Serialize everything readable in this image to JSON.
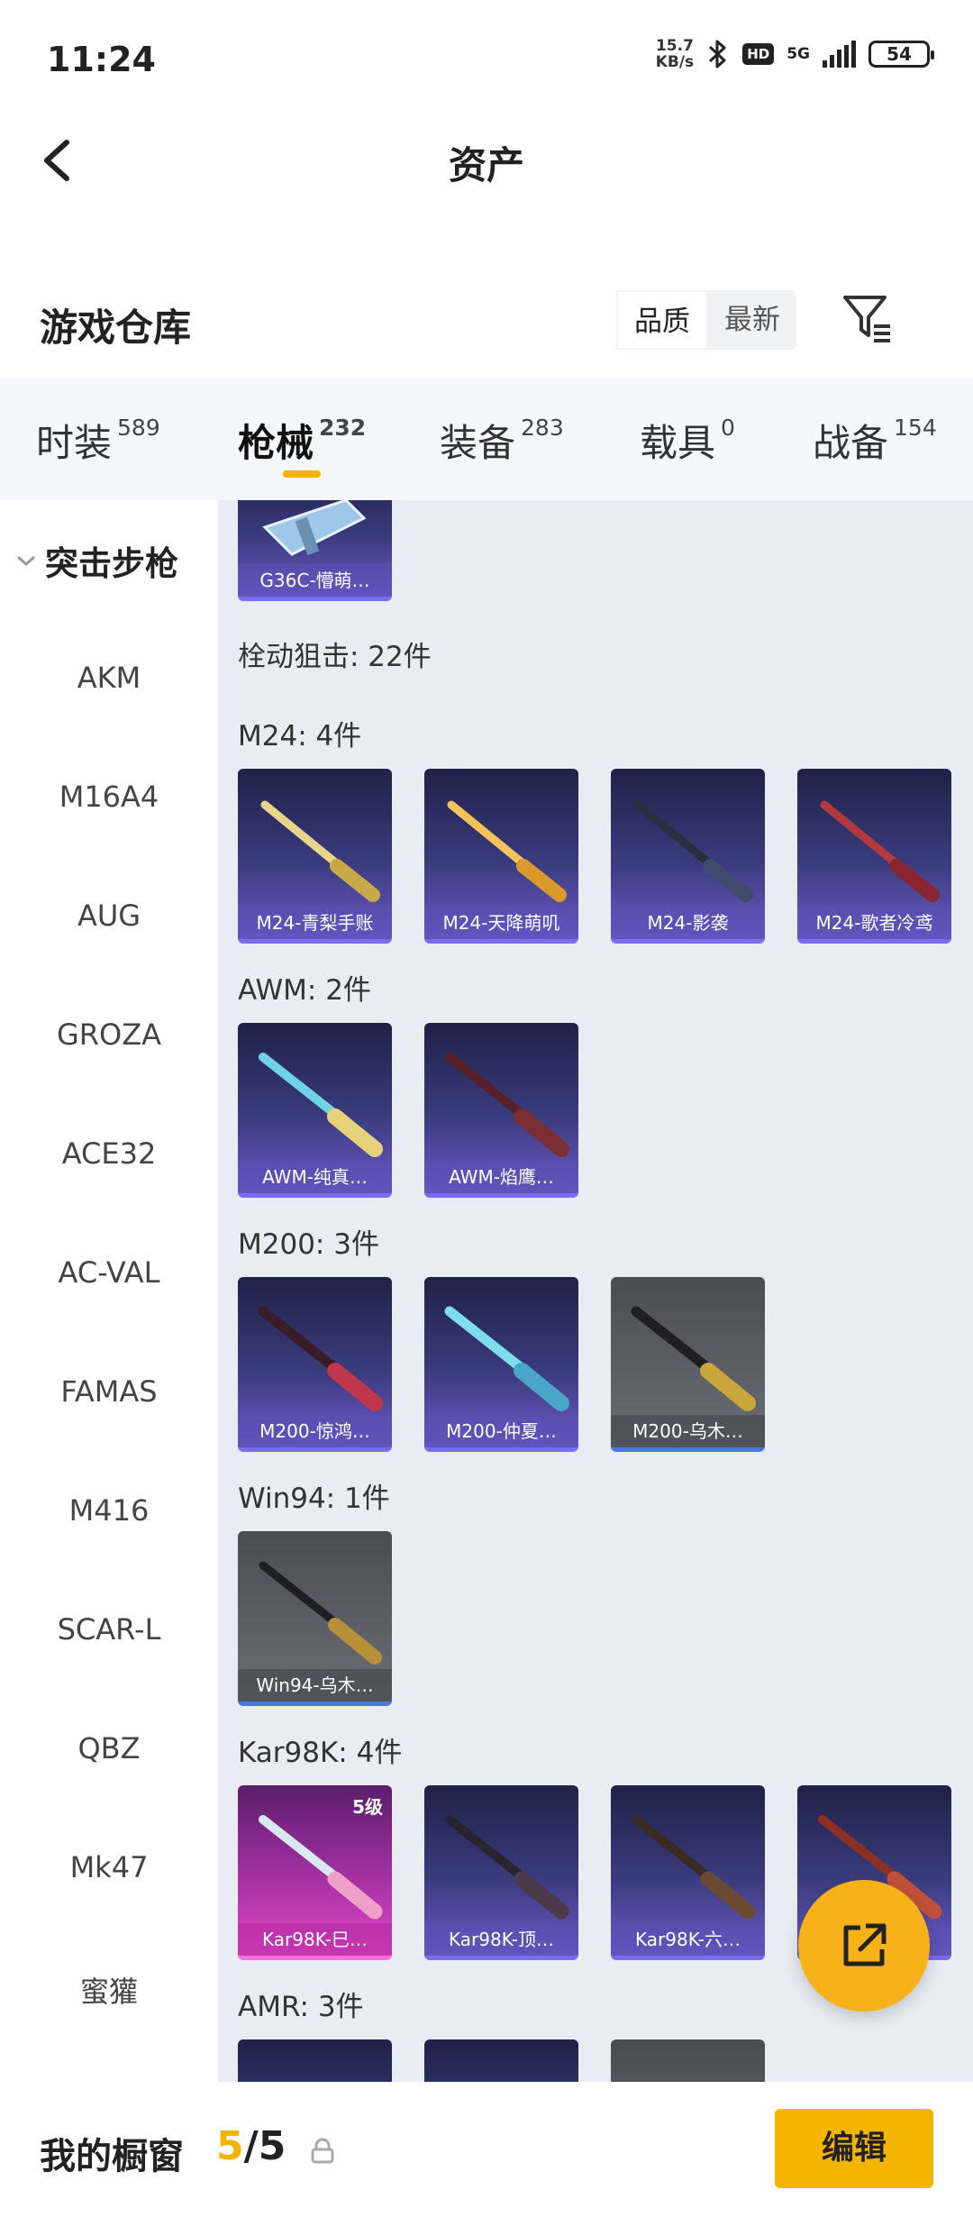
{
  "status_bar": {
    "time": "11:24",
    "net_speed_value": "15.7",
    "net_speed_unit": "KB/s",
    "hd_badge": "HD",
    "network": "5G",
    "battery": "54"
  },
  "header": {
    "title": "资产"
  },
  "section": {
    "title": "游戏仓库",
    "sort_options": [
      "品质",
      "最新"
    ],
    "sort_selected": "品质"
  },
  "tabs": [
    {
      "label": "时装",
      "count": "589"
    },
    {
      "label": "枪械",
      "count": "232"
    },
    {
      "label": "装备",
      "count": "283"
    },
    {
      "label": "载具",
      "count": "0"
    },
    {
      "label": "战备",
      "count": "154"
    }
  ],
  "active_tab": "枪械",
  "sidebar": {
    "category": "突击步枪",
    "items": [
      "AKM",
      "M16A4",
      "AUG",
      "GROZA",
      "ACE32",
      "AC-VAL",
      "FAMAS",
      "M416",
      "SCAR-L",
      "QBZ",
      "Mk47",
      "蜜獾"
    ]
  },
  "content": {
    "top_card": "G36C-懵萌…",
    "category_heading": "栓动狙击: 22件",
    "groups": [
      {
        "label": "M24: 4件",
        "items": [
          "M24-青梨手账",
          "M24-天降萌叽",
          "M24-影袭",
          "M24-歌者冷鸢"
        ]
      },
      {
        "label": "AWM: 2件",
        "items": [
          "AWM-纯真…",
          "AWM-焰鹰…"
        ]
      },
      {
        "label": "M200: 3件",
        "items": [
          "M200-惊鸿…",
          "M200-仲夏…",
          "M200-乌木…"
        ]
      },
      {
        "label": "Win94: 1件",
        "items": [
          "Win94-乌木…"
        ]
      },
      {
        "label": "Kar98K: 4件",
        "items": [
          "Kar98K-巳…",
          "Kar98K-顶…",
          "Kar98K-六…",
          ""
        ]
      },
      {
        "label": "AMR: 3件",
        "items": []
      }
    ],
    "kar_level_badge": "5级"
  },
  "bottom_bar": {
    "label": "我的橱窗",
    "current": "5",
    "separator": "/",
    "total": "5",
    "edit_button": "编辑"
  },
  "colors": {
    "accent": "#f5b400",
    "tab_bg": "#f5f7fa",
    "content_bg": "#e9ecf2",
    "card_purple": "#3a3b7d",
    "card_grey": "#6b6e75",
    "card_pink": "#a531a4"
  }
}
